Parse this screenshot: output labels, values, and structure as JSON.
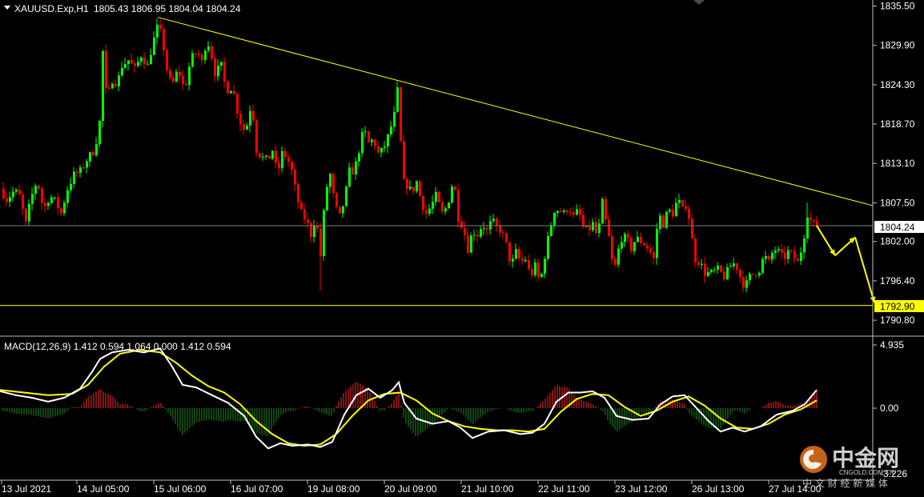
{
  "header": {
    "symbol_text": "XAUUSD.Exp,H1",
    "ohlc_text": "1805.43 1806.95 1804.04 1804.24"
  },
  "macd_header": {
    "text": "MACD(12,26,9) 1.412 0.594 1.064 0.000 1.412 0.594"
  },
  "price_axis": {
    "ticks": [
      "1835.50",
      "1829.90",
      "1824.30",
      "1818.70",
      "1813.10",
      "1807.50",
      "1802.00",
      "1796.40",
      "1790.80"
    ],
    "current_price_label": "1804.24",
    "support_label": "1792.90"
  },
  "macd_axis": {
    "ticks": [
      "4.935",
      "0.00"
    ],
    "bottom_label": "-3.226"
  },
  "time_axis": {
    "ticks": [
      "13 Jul 2021",
      "14 Jul 05:00",
      "15 Jul 06:00",
      "16 Jul 07:00",
      "19 Jul 08:00",
      "20 Jul 09:00",
      "21 Jul 10:00",
      "22 Jul 11:00",
      "23 Jul 12:00",
      "26 Jul 13:00",
      "27 Jul 14:00"
    ]
  },
  "watermark": {
    "brand_cn": "中金网",
    "brand_en": "CNGOLD.COM.CN",
    "tagline_cn": "中 文 财 经 新 媒 体"
  },
  "colors": {
    "background": "#000000",
    "bull_candle": "#00ff00",
    "bear_candle": "#ff0000",
    "trend_line": "#ffff00",
    "support_line": "#ffff00",
    "macd_line": "#ffffff",
    "signal_line": "#ffff00",
    "hist_positive": "#ff2a2a",
    "hist_negative": "#1f8a1f",
    "axis_text": "#ffffff",
    "grid": "#808080"
  },
  "chart_data": [
    {
      "type": "candlestick",
      "symbol": "XAUUSD.Exp",
      "timeframe": "H1",
      "current_price": 1804.24,
      "ylim": [
        1788.5,
        1836.6
      ],
      "y_ticks": [
        1835.5,
        1829.9,
        1824.3,
        1818.7,
        1813.1,
        1807.5,
        1802.0,
        1796.4,
        1790.8
      ],
      "x_labels": [
        "13 Jul 2021",
        "14 Jul 05:00",
        "15 Jul 06:00",
        "16 Jul 07:00",
        "19 Jul 08:00",
        "20 Jul 09:00",
        "21 Jul 10:00",
        "22 Jul 11:00",
        "23 Jul 12:00",
        "26 Jul 13:00",
        "27 Jul 14:00"
      ],
      "price_path": [
        [
          0,
          1809.5
        ],
        [
          8,
          1808.0
        ],
        [
          18,
          1809.3
        ],
        [
          24,
          1808.4
        ],
        [
          32,
          1804.5
        ],
        [
          38,
          1808.0
        ],
        [
          46,
          1810.8
        ],
        [
          54,
          1806.5
        ],
        [
          62,
          1808.5
        ],
        [
          68,
          1807.8
        ],
        [
          76,
          1806.0
        ],
        [
          84,
          1809.5
        ],
        [
          92,
          1811.5
        ],
        [
          100,
          1812.0
        ],
        [
          110,
          1814.0
        ],
        [
          118,
          1815.0
        ],
        [
          124,
          1819.0
        ],
        [
          128,
          1829.0
        ],
        [
          133,
          1822.0
        ],
        [
          140,
          1825.0
        ],
        [
          146,
          1824.5
        ],
        [
          152,
          1827.0
        ],
        [
          160,
          1827.8
        ],
        [
          168,
          1826.5
        ],
        [
          176,
          1828.5
        ],
        [
          184,
          1827.0
        ],
        [
          190,
          1830.0
        ],
        [
          197,
          1832.8
        ],
        [
          202,
          1831.0
        ],
        [
          208,
          1826.5
        ],
        [
          214,
          1824.0
        ],
        [
          222,
          1826.5
        ],
        [
          230,
          1823.5
        ],
        [
          238,
          1828.0
        ],
        [
          246,
          1829.0
        ],
        [
          252,
          1827.5
        ],
        [
          258,
          1830.8
        ],
        [
          262,
          1829.5
        ],
        [
          268,
          1826.0
        ],
        [
          276,
          1827.0
        ],
        [
          282,
          1823.5
        ],
        [
          290,
          1824.0
        ],
        [
          298,
          1819.5
        ],
        [
          306,
          1817.5
        ],
        [
          314,
          1822.0
        ],
        [
          320,
          1815.0
        ],
        [
          326,
          1814.0
        ],
        [
          334,
          1813.5
        ],
        [
          340,
          1815.0
        ],
        [
          346,
          1811.5
        ],
        [
          352,
          1814.5
        ],
        [
          358,
          1814.0
        ],
        [
          364,
          1812.0
        ],
        [
          370,
          1808.5
        ],
        [
          376,
          1806.0
        ],
        [
          382,
          1805.0
        ],
        [
          388,
          1803.0
        ],
        [
          394,
          1805.5
        ],
        [
          400,
          1800.0
        ],
        [
          406,
          1809.0
        ],
        [
          412,
          1811.5
        ],
        [
          418,
          1807.0
        ],
        [
          424,
          1805.5
        ],
        [
          430,
          1808.0
        ],
        [
          436,
          1812.0
        ],
        [
          442,
          1812.0
        ],
        [
          448,
          1815.0
        ],
        [
          454,
          1818.0
        ],
        [
          460,
          1816.0
        ],
        [
          466,
          1816.5
        ],
        [
          472,
          1814.5
        ],
        [
          478,
          1815.0
        ],
        [
          486,
          1817.5
        ],
        [
          492,
          1820.0
        ],
        [
          497,
          1824.3
        ],
        [
          502,
          1810.5
        ],
        [
          508,
          1810.0
        ],
        [
          514,
          1809.0
        ],
        [
          520,
          1810.5
        ],
        [
          526,
          1807.5
        ],
        [
          532,
          1806.0
        ],
        [
          538,
          1807.0
        ],
        [
          544,
          1808.5
        ],
        [
          552,
          1806.0
        ],
        [
          558,
          1807.0
        ],
        [
          566,
          1811.0
        ],
        [
          572,
          1805.5
        ],
        [
          578,
          1804.0
        ],
        [
          584,
          1801.0
        ],
        [
          590,
          1803.5
        ],
        [
          596,
          1803.0
        ],
        [
          602,
          1804.5
        ],
        [
          608,
          1803.5
        ],
        [
          614,
          1805.0
        ],
        [
          620,
          1804.0
        ],
        [
          626,
          1803.5
        ],
        [
          632,
          1801.5
        ],
        [
          638,
          1798.5
        ],
        [
          644,
          1800.5
        ],
        [
          650,
          1799.0
        ],
        [
          656,
          1799.5
        ],
        [
          662,
          1797.0
        ],
        [
          668,
          1798.5
        ],
        [
          674,
          1796.0
        ],
        [
          680,
          1800.0
        ],
        [
          686,
          1803.5
        ],
        [
          692,
          1806.5
        ],
        [
          698,
          1806.5
        ],
        [
          704,
          1806.0
        ],
        [
          710,
          1807.0
        ],
        [
          716,
          1805.5
        ],
        [
          722,
          1806.5
        ],
        [
          728,
          1804.0
        ],
        [
          734,
          1803.5
        ],
        [
          740,
          1804.5
        ],
        [
          746,
          1802.5
        ],
        [
          752,
          1807.5
        ],
        [
          758,
          1803.5
        ],
        [
          762,
          1801.5
        ],
        [
          766,
          1797.0
        ],
        [
          770,
          1800.0
        ],
        [
          776,
          1802.5
        ],
        [
          782,
          1802.5
        ],
        [
          788,
          1801.0
        ],
        [
          794,
          1802.5
        ],
        [
          800,
          1802.0
        ],
        [
          806,
          1801.5
        ],
        [
          812,
          1800.5
        ],
        [
          816,
          1799.5
        ],
        [
          822,
          1806.0
        ],
        [
          828,
          1804.5
        ],
        [
          834,
          1806.5
        ],
        [
          840,
          1806.0
        ],
        [
          846,
          1808.0
        ],
        [
          852,
          1806.5
        ],
        [
          858,
          1807.5
        ],
        [
          862,
          1803.5
        ],
        [
          868,
          1799.5
        ],
        [
          874,
          1799.0
        ],
        [
          880,
          1797.5
        ],
        [
          888,
          1797.5
        ],
        [
          896,
          1798.0
        ],
        [
          904,
          1797.0
        ],
        [
          912,
          1798.5
        ],
        [
          918,
          1799.0
        ],
        [
          924,
          1797.0
        ],
        [
          930,
          1795.5
        ],
        [
          936,
          1797.0
        ],
        [
          942,
          1797.5
        ],
        [
          948,
          1798.0
        ],
        [
          954,
          1800.0
        ],
        [
          960,
          1799.0
        ],
        [
          966,
          1801.0
        ],
        [
          972,
          1800.5
        ],
        [
          978,
          1799.5
        ],
        [
          984,
          1800.5
        ],
        [
          990,
          1800.0
        ],
        [
          996,
          1799.0
        ],
        [
          1002,
          1801.5
        ],
        [
          1008,
          1806.0
        ],
        [
          1014,
          1804.5
        ],
        [
          1020,
          1804.24
        ]
      ],
      "trend_line": {
        "from": {
          "x_label": "15 Jul 06:00",
          "price": 1833.9
        },
        "to_price_at_axis": 1807.1,
        "color": "#ffff00"
      },
      "support_line": {
        "price": 1792.9,
        "label": "1792.90",
        "color": "#ffff00"
      },
      "forecast_path_prices": [
        1804.24,
        1800.0,
        1802.6,
        1793.3
      ]
    },
    {
      "type": "line",
      "indicator": "MACD",
      "params": [
        12,
        26,
        9
      ],
      "header_values": [
        1.412,
        0.594,
        1.064,
        0.0,
        1.412,
        0.594
      ],
      "ylim": [
        -3.226,
        4.935
      ],
      "y_ticks": [
        4.935,
        0.0
      ],
      "series": [
        {
          "name": "MACD",
          "color": "#ffffff"
        },
        {
          "name": "Signal",
          "color": "#ffff00"
        }
      ],
      "macd_path": [
        [
          0,
          1.3
        ],
        [
          20,
          1.0
        ],
        [
          40,
          0.8
        ],
        [
          60,
          0.5
        ],
        [
          80,
          0.8
        ],
        [
          100,
          1.5
        ],
        [
          115,
          2.8
        ],
        [
          125,
          3.8
        ],
        [
          140,
          4.3
        ],
        [
          160,
          4.5
        ],
        [
          180,
          4.3
        ],
        [
          200,
          4.6
        ],
        [
          215,
          3.2
        ],
        [
          228,
          1.8
        ],
        [
          245,
          1.6
        ],
        [
          265,
          1.0
        ],
        [
          285,
          0.4
        ],
        [
          305,
          -0.6
        ],
        [
          320,
          -2.2
        ],
        [
          335,
          -3.1
        ],
        [
          350,
          -2.7
        ],
        [
          365,
          -2.9
        ],
        [
          385,
          -2.8
        ],
        [
          400,
          -3.0
        ],
        [
          415,
          -2.6
        ],
        [
          430,
          -0.5
        ],
        [
          445,
          1.0
        ],
        [
          460,
          1.5
        ],
        [
          475,
          0.8
        ],
        [
          490,
          1.4
        ],
        [
          498,
          2.0
        ],
        [
          505,
          0.4
        ],
        [
          520,
          -0.8
        ],
        [
          540,
          -1.2
        ],
        [
          560,
          -1.0
        ],
        [
          575,
          -1.5
        ],
        [
          590,
          -2.3
        ],
        [
          610,
          -1.8
        ],
        [
          630,
          -1.7
        ],
        [
          650,
          -2.0
        ],
        [
          665,
          -1.9
        ],
        [
          680,
          -1.2
        ],
        [
          695,
          0.5
        ],
        [
          710,
          1.2
        ],
        [
          725,
          1.2
        ],
        [
          740,
          1.3
        ],
        [
          755,
          0.8
        ],
        [
          770,
          -0.6
        ],
        [
          790,
          -0.9
        ],
        [
          810,
          -0.8
        ],
        [
          825,
          0.3
        ],
        [
          840,
          0.9
        ],
        [
          855,
          1.0
        ],
        [
          870,
          0.0
        ],
        [
          885,
          -1.0
        ],
        [
          900,
          -1.8
        ],
        [
          915,
          -1.5
        ],
        [
          930,
          -1.8
        ],
        [
          950,
          -1.4
        ],
        [
          970,
          -0.5
        ],
        [
          990,
          -0.2
        ],
        [
          1005,
          0.3
        ],
        [
          1020,
          1.4
        ]
      ],
      "signal_path": [
        [
          0,
          1.4
        ],
        [
          30,
          1.2
        ],
        [
          60,
          1.0
        ],
        [
          90,
          1.1
        ],
        [
          110,
          1.8
        ],
        [
          130,
          3.2
        ],
        [
          150,
          4.2
        ],
        [
          175,
          4.5
        ],
        [
          200,
          4.3
        ],
        [
          220,
          3.5
        ],
        [
          240,
          2.5
        ],
        [
          260,
          1.7
        ],
        [
          280,
          1.2
        ],
        [
          300,
          0.3
        ],
        [
          320,
          -1.0
        ],
        [
          340,
          -2.0
        ],
        [
          360,
          -2.7
        ],
        [
          380,
          -2.9
        ],
        [
          400,
          -2.8
        ],
        [
          420,
          -2.0
        ],
        [
          440,
          -0.6
        ],
        [
          460,
          0.6
        ],
        [
          480,
          1.1
        ],
        [
          500,
          1.2
        ],
        [
          520,
          0.6
        ],
        [
          540,
          -0.4
        ],
        [
          560,
          -1.0
        ],
        [
          580,
          -1.4
        ],
        [
          600,
          -1.6
        ],
        [
          620,
          -1.7
        ],
        [
          640,
          -1.7
        ],
        [
          660,
          -1.8
        ],
        [
          680,
          -1.6
        ],
        [
          700,
          -0.3
        ],
        [
          720,
          0.7
        ],
        [
          740,
          1.1
        ],
        [
          760,
          1.0
        ],
        [
          780,
          0.1
        ],
        [
          800,
          -0.6
        ],
        [
          820,
          -0.2
        ],
        [
          840,
          0.5
        ],
        [
          860,
          0.9
        ],
        [
          880,
          0.2
        ],
        [
          900,
          -0.8
        ],
        [
          920,
          -1.5
        ],
        [
          940,
          -1.6
        ],
        [
          960,
          -1.2
        ],
        [
          980,
          -0.5
        ],
        [
          1000,
          -0.1
        ],
        [
          1020,
          0.6
        ]
      ]
    }
  ]
}
